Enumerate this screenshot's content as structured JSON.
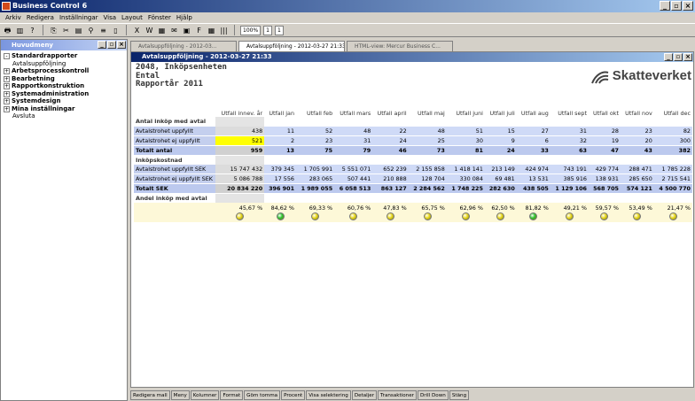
{
  "app": {
    "title": "Business Control 6"
  },
  "menu": [
    "Arkiv",
    "Redigera",
    "Inställningar",
    "Visa",
    "Layout",
    "Fönster",
    "Hjälp"
  ],
  "toolbar": {
    "zoom": "100%",
    "page": "1",
    "pages": "1"
  },
  "nav": {
    "title": "Huvudmeny",
    "items": [
      {
        "label": "Standardrapporter",
        "bold": true,
        "sign": "-"
      },
      {
        "label": "Avtalsuppföljning",
        "bold": false
      },
      {
        "label": "Arbetsprocesskontroll",
        "bold": true,
        "sign": "+"
      },
      {
        "label": "Bearbetning",
        "bold": true,
        "sign": "+"
      },
      {
        "label": "Rapportkonstruktion",
        "bold": true,
        "sign": "+"
      },
      {
        "label": "Systemadministration",
        "bold": true,
        "sign": "+"
      },
      {
        "label": "Systemdesign",
        "bold": true,
        "sign": "+"
      },
      {
        "label": "Mina inställningar",
        "bold": true,
        "sign": "+"
      },
      {
        "label": "Avsluta",
        "bold": false
      }
    ]
  },
  "tabs": [
    "Avtalsuppföljning - 2012-03...",
    "Avtalsuppföljning - 2012-03-27 21:33",
    "HTML-view: Mercur Business C..."
  ],
  "doc": {
    "window_title": "Avtalsuppföljning - 2012-03-27 21:33",
    "header_line1": "2048, Inköpsenheten",
    "header_line2": "Ental",
    "header_line3": "Rapportår 2011",
    "logo_text": "Skatteverket"
  },
  "columns": [
    "Utfall innev. år",
    "Utfall jan",
    "Utfall feb",
    "Utfall mars",
    "Utfall april",
    "Utfall maj",
    "Utfall juni",
    "Utfall juli",
    "Utfall aug",
    "Utfall sept",
    "Utfall okt",
    "Utfall nov",
    "Utfall dec"
  ],
  "rows": [
    {
      "kind": "section",
      "label": "Antal inköp med avtal",
      "values": []
    },
    {
      "kind": "blue",
      "label": "Avtalstrohet uppfyllt",
      "values": [
        "438",
        "11",
        "52",
        "48",
        "22",
        "48",
        "51",
        "15",
        "27",
        "31",
        "28",
        "23",
        "82"
      ]
    },
    {
      "kind": "blue",
      "label": "Avtalstrohet ej uppfyllt",
      "values": [
        "521",
        "2",
        "23",
        "31",
        "24",
        "25",
        "30",
        "9",
        "6",
        "32",
        "19",
        "20",
        "300"
      ],
      "highlight": 0
    },
    {
      "kind": "total",
      "label": "Totalt antal",
      "values": [
        "959",
        "13",
        "75",
        "79",
        "46",
        "73",
        "81",
        "24",
        "33",
        "63",
        "47",
        "43",
        "382"
      ]
    },
    {
      "kind": "section",
      "label": "Inköpskostnad",
      "values": []
    },
    {
      "kind": "blue",
      "label": "Avtalstrohet uppfyllt SEK",
      "values": [
        "15 747 432",
        "379 345",
        "1 705 991",
        "5 551 071",
        "652 239",
        "2 155 858",
        "1 418 141",
        "213 149",
        "424 974",
        "743 191",
        "429 774",
        "288 471",
        "1 785 228"
      ]
    },
    {
      "kind": "blue",
      "label": "Avtalstrohet ej uppfyllt SEK",
      "values": [
        "5 086 788",
        "17 556",
        "283 065",
        "507 441",
        "210 888",
        "128 704",
        "330 084",
        "69 481",
        "13 531",
        "385 916",
        "138 931",
        "285 650",
        "2 715 541"
      ]
    },
    {
      "kind": "total",
      "label": "Totalt SEK",
      "values": [
        "20 834 220",
        "396 901",
        "1 989 055",
        "6 058 513",
        "863 127",
        "2 284 562",
        "1 748 225",
        "282 630",
        "438 505",
        "1 129 106",
        "568 705",
        "574 121",
        "4 500 770"
      ]
    },
    {
      "kind": "section",
      "label": "Andel inköp med avtal",
      "values": []
    }
  ],
  "share": {
    "values": [
      "45,67 %",
      "84,62 %",
      "69,33 %",
      "60,76 %",
      "47,83 %",
      "65,75 %",
      "62,96 %",
      "62,50 %",
      "81,82 %",
      "49,21 %",
      "59,57 %",
      "53,49 %",
      "21,47 %"
    ],
    "lamps": [
      "yellow",
      "green",
      "yellow",
      "yellow",
      "yellow",
      "yellow",
      "yellow",
      "yellow",
      "green",
      "yellow",
      "yellow",
      "yellow",
      "yellow"
    ]
  },
  "colors": {
    "yellow_lamp": "#e8d81c",
    "green_lamp": "#2ec42e",
    "highlight": "#ffff00"
  },
  "bottom_buttons": [
    "Redigera mall",
    "Meny",
    "Kolumner",
    "Format",
    "Göm tomma",
    "Procent",
    "Visa selektering",
    "Detaljer",
    "Transaktioner",
    "Drill Down",
    "Stäng"
  ]
}
